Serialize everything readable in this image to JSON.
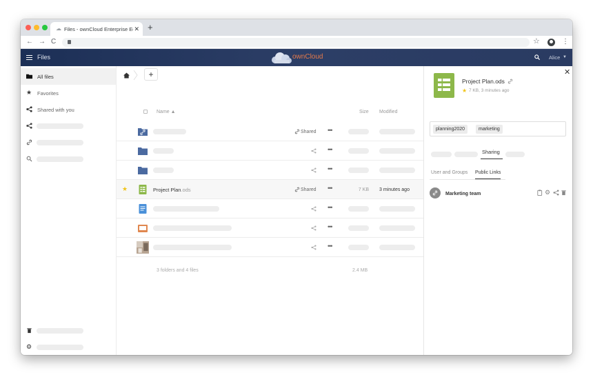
{
  "browser": {
    "tab_title": "Files - ownCloud Enterprise Edit",
    "tab_close": "✕",
    "new_tab": "+",
    "nav_back": "←",
    "nav_forward": "→",
    "nav_reload": "C",
    "star": "☆",
    "menu": "⋮"
  },
  "header": {
    "app_name": "Files",
    "logo_text": "ownCloud",
    "user_name": "Alice",
    "user_caret": "▼",
    "accent": "#e67a4a",
    "bg": "#1f3259"
  },
  "sidebar": {
    "items": [
      {
        "label": "All files",
        "icon": "folder-icon",
        "active": true
      },
      {
        "label": "Favorites",
        "icon": "star-icon"
      },
      {
        "label": "Shared with you",
        "icon": "share-icon"
      }
    ],
    "placeholder_icons": [
      "share-icon",
      "link-icon",
      "search-icon"
    ],
    "bottom_icons": [
      "trash-icon",
      "gear-icon"
    ]
  },
  "main": {
    "add_label": "+",
    "columns": {
      "name": "Name ▲",
      "size": "Size",
      "modified": "Modified"
    },
    "rows": [
      {
        "icon": "link-folder-icon",
        "shared": "Shared"
      },
      {
        "icon": "folder-icon"
      },
      {
        "icon": "folder-icon"
      },
      {
        "icon": "spreadsheet-icon",
        "favorite": "★",
        "name": "Project Plan",
        "ext": ".ods",
        "shared": "Shared",
        "size": "7 KB",
        "modified": "3 minutes ago"
      },
      {
        "icon": "document-icon"
      },
      {
        "icon": "presentation-icon"
      },
      {
        "icon": "image-thumbnail-icon"
      }
    ],
    "more_label": "•••",
    "summary": {
      "count": "3 folders and 4 files",
      "size": "2.4 MB"
    }
  },
  "details": {
    "close_label": "✕",
    "title": "Project Plan.ods",
    "star": "★",
    "meta": "7 KB, 3 minutes ago",
    "tags": [
      "planning2020",
      "marketing"
    ],
    "tabs": [
      "Sharing"
    ],
    "subtabs": [
      "User and Groups",
      "Public Links"
    ],
    "link_name": "Marketing team",
    "spreadsheet_color": "#8db84a"
  }
}
